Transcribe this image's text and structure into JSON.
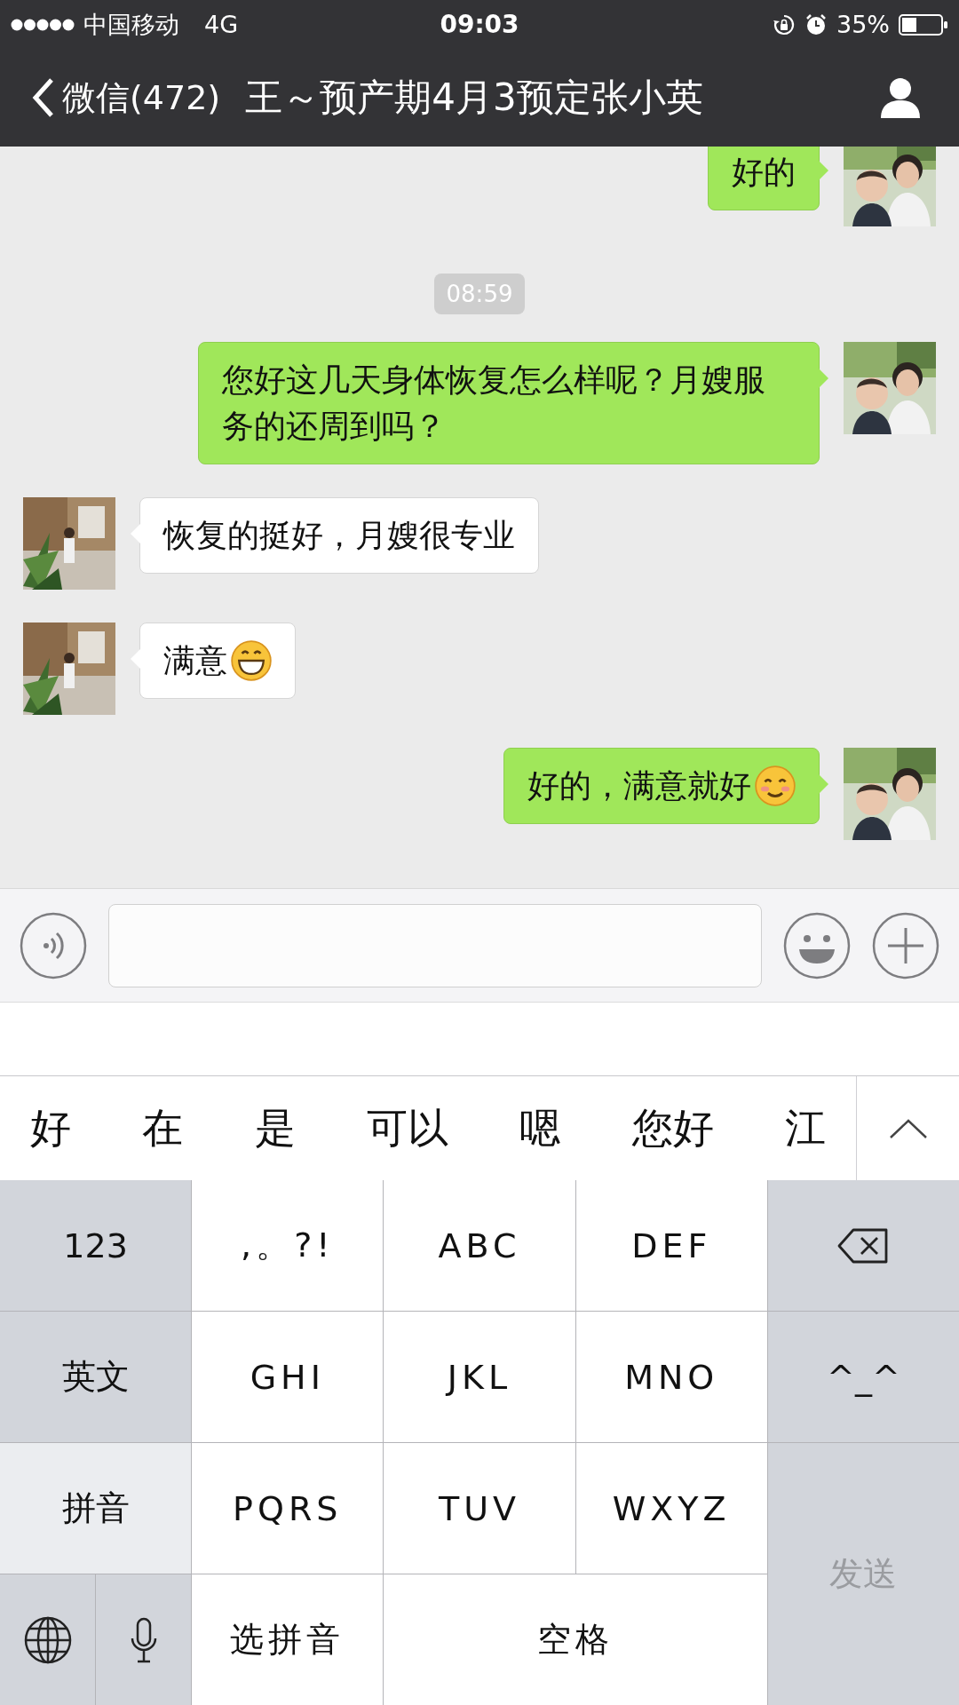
{
  "status_bar": {
    "carrier": "中国移动",
    "network": "4G",
    "time": "09:03",
    "battery": "35%"
  },
  "nav": {
    "back": "微信(472)",
    "title": "王～预产期4月3预定张小英"
  },
  "messages": [
    {
      "kind": "sent",
      "parts": [
        {
          "kind": "text",
          "text": "好的"
        }
      ]
    },
    {
      "kind": "time",
      "text": "08:59"
    },
    {
      "kind": "sent",
      "parts": [
        {
          "kind": "text",
          "text": "您好这几天身体恢复怎么样呢？月嫂服务的还周到吗？"
        }
      ]
    },
    {
      "kind": "received",
      "parts": [
        {
          "kind": "text",
          "text": "恢复的挺好，月嫂很专业"
        }
      ]
    },
    {
      "kind": "received",
      "parts": [
        {
          "kind": "text",
          "text": "满意"
        },
        {
          "kind": "grin_emoji"
        }
      ]
    },
    {
      "kind": "sent",
      "parts": [
        {
          "kind": "text",
          "text": "好的，满意就好"
        },
        {
          "kind": "blush_emoji"
        }
      ]
    }
  ],
  "candidates": [
    "好",
    "在",
    "是",
    "可以",
    "嗯",
    "您好",
    "江"
  ],
  "keys": [
    {
      "kind": "function",
      "label": "123",
      "selected": false
    },
    {
      "kind": "text",
      "label": ",。?!"
    },
    {
      "kind": "text",
      "label": "ABC"
    },
    {
      "kind": "text",
      "label": "DEF"
    },
    {
      "kind": "backspace"
    },
    {
      "kind": "function",
      "label": "英文",
      "selected": false
    },
    {
      "kind": "text",
      "label": "GHI"
    },
    {
      "kind": "text",
      "label": "JKL"
    },
    {
      "kind": "text",
      "label": "MNO"
    },
    {
      "kind": "function",
      "label": "^_^",
      "selected": false
    },
    {
      "kind": "function",
      "label": "拼音",
      "selected": true
    },
    {
      "kind": "text",
      "label": "PQRS"
    },
    {
      "kind": "text",
      "label": "TUV"
    },
    {
      "kind": "text",
      "label": "WXYZ"
    },
    {
      "kind": "send",
      "label": "发送",
      "disabled": true
    },
    {
      "kind": "globe"
    },
    {
      "kind": "mic"
    },
    {
      "kind": "text",
      "label": "选拼音"
    },
    {
      "kind": "space",
      "label": "空格"
    }
  ]
}
